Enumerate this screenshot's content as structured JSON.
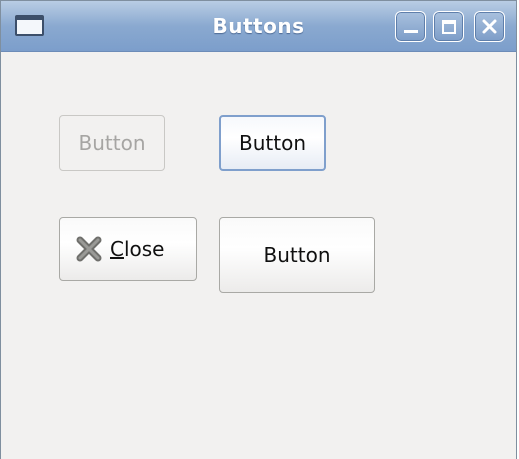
{
  "window": {
    "title": "Buttons"
  },
  "buttons": {
    "disabled_label": "Button",
    "focused_label": "Button",
    "close_mnemonic": "C",
    "close_rest": "lose",
    "large_label": "Button"
  },
  "colors": {
    "titlebar": "#8aa9d0",
    "window_bg": "#f2f1f0",
    "focus_border": "#7f9fcc",
    "disabled_text": "#a6a5a3"
  },
  "icons": {
    "window": "window-icon",
    "minimize": "minimize-icon",
    "maximize": "maximize-icon",
    "close": "close-icon",
    "close_button_icon": "close-x-icon"
  }
}
